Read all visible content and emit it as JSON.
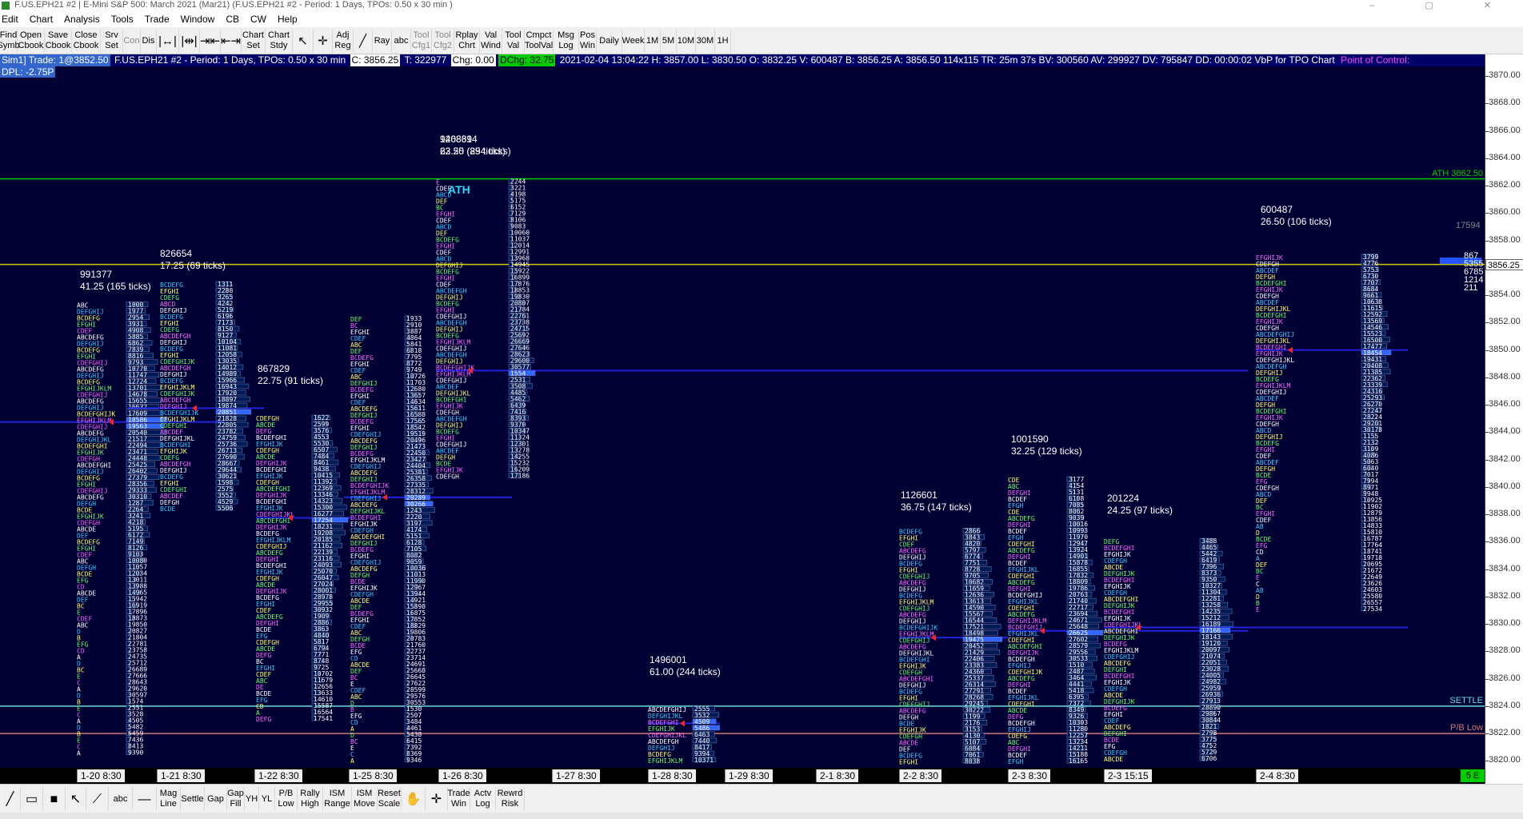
{
  "window": {
    "title": "F.US.EPH21  #2 | E-Mini S&P 500: March 2021 (Mar21) (F.US.EPH21  #2 - Period: 1 Days, TPOs: 0.50 x 30 min )"
  },
  "menu": [
    "Edit",
    "Chart",
    "Analysis",
    "Tools",
    "Trade",
    "Window",
    "CB",
    "CW",
    "Help"
  ],
  "toolbar": {
    "buttons": [
      {
        "label": "Find\nSymb",
        "icon": null,
        "enabled": true
      },
      {
        "label": "Open\nCbook",
        "icon": null,
        "enabled": true
      },
      {
        "label": "Save\nCbook",
        "icon": null,
        "enabled": true
      },
      {
        "label": "Close\nCbook",
        "icon": null,
        "enabled": true
      },
      {
        "label": "Srv\nSet",
        "icon": null,
        "enabled": true
      },
      {
        "label": "Con",
        "icon": null,
        "enabled": false
      },
      {
        "label": "Dis",
        "icon": null,
        "enabled": true
      },
      {
        "label": "",
        "icon": "zoom-out-bars-icon",
        "enabled": true
      },
      {
        "label": "",
        "icon": "zoom-in-bars-icon",
        "enabled": true
      },
      {
        "label": "",
        "icon": "compress-icon",
        "enabled": true
      },
      {
        "label": "",
        "icon": "expand-icon",
        "enabled": true
      },
      {
        "label": "Chart\nSet",
        "icon": null,
        "enabled": true
      },
      {
        "label": "Chart\nStdy",
        "icon": null,
        "enabled": true
      },
      {
        "label": "",
        "icon": "pointer-icon",
        "enabled": true
      },
      {
        "label": "",
        "icon": "crosshair-icon",
        "enabled": true
      },
      {
        "label": "Adj\nReg",
        "icon": null,
        "enabled": true
      },
      {
        "label": "",
        "icon": "line-draw-icon",
        "enabled": true
      },
      {
        "label": "Ray",
        "icon": null,
        "enabled": true
      },
      {
        "label": "abc",
        "icon": null,
        "enabled": true
      },
      {
        "label": "Tool\nCfg1",
        "icon": null,
        "enabled": false
      },
      {
        "label": "Tool\nCfg2",
        "icon": null,
        "enabled": false
      },
      {
        "label": "Rplay\nChrt",
        "icon": null,
        "enabled": true
      },
      {
        "label": "Val\nWind",
        "icon": null,
        "enabled": true
      },
      {
        "label": "Tool\nVal",
        "icon": null,
        "enabled": true
      },
      {
        "label": "Cmpct\nToolVal",
        "icon": null,
        "enabled": true
      },
      {
        "label": "Msg\nLog",
        "icon": null,
        "enabled": true
      },
      {
        "label": "Pos\nWin",
        "icon": null,
        "enabled": true
      },
      {
        "label": "Daily",
        "icon": null,
        "enabled": true
      },
      {
        "label": "Week",
        "icon": null,
        "enabled": true
      },
      {
        "label": "1M",
        "icon": null,
        "enabled": true
      },
      {
        "label": "5M",
        "icon": null,
        "enabled": true
      },
      {
        "label": "10M",
        "icon": null,
        "enabled": true
      },
      {
        "label": "30M",
        "icon": null,
        "enabled": true
      },
      {
        "label": "1H",
        "icon": null,
        "enabled": true
      }
    ]
  },
  "infobar": {
    "sim": "Sim1]  Trade: 1@3852.50",
    "symbol": "F.US.EPH21  #2 - Period: 1 Days, TPOs: 0.50 x 30 min",
    "c": "C: 3856.25",
    "t": "T: 322977",
    "chg": "Chg: 0.00",
    "dchg": "DChg: 32.75",
    "stats": "2021-02-04  13:04:22  H: 3857.00  L: 3830.50  O: 3832.25  V: 600487  B: 3856.25  A: 3856.50  114x115  TR: 25m 37s  BV: 300560  AV: 299927  DV: 795847  DD: 00:00:02  VbP for TPO Chart",
    "poc": "Point of Control:",
    "dpl": "DPL: -2.75P"
  },
  "dates": [
    "1-20  8:30",
    "1-21  8:30",
    "1-22  8:30",
    "1-25  8:30",
    "1-26  8:30",
    "1-27  8:30",
    "1-28  8:30",
    "1-29  8:30",
    "2-1  8:30",
    "2-2  8:30",
    "2-3  8:30",
    "2-3  15:15",
    "2-4  8:30"
  ],
  "date_corner": "5 E",
  "price_axis": {
    "labels": [
      "3870.00",
      "3868.00",
      "3866.00",
      "3864.00",
      "3862.00",
      "3860.00",
      "3858.00",
      "3856.00",
      "3854.00",
      "3852.00",
      "3850.00",
      "3848.00",
      "3846.00",
      "3844.00",
      "3842.00",
      "3840.00",
      "3838.00",
      "3836.00",
      "3834.00",
      "3832.00",
      "3830.00",
      "3828.00",
      "3826.00",
      "3824.00",
      "3822.00",
      "3820.00"
    ],
    "current": "3856.25"
  },
  "chart_data": {
    "type": "tpo-profile",
    "symbol": "F.US.EPH21",
    "y_range": [
      3819.5,
      3871
    ],
    "reference_lines": [
      {
        "name": "ATH",
        "label": "ATH  3862.50",
        "price": 3862.5,
        "color": "#00cc00"
      },
      {
        "name": "current",
        "price": 3856.25,
        "color": "#cccc00"
      },
      {
        "name": "SETTLE",
        "label": "SETTLE",
        "price": 3824.0,
        "color": "#66dddd"
      },
      {
        "name": "P/B Low",
        "label": "P/B Low",
        "price": 3822.0,
        "color": "#cc7777"
      }
    ],
    "right_vol": [
      {
        "label": "17594"
      },
      {
        "label": "867"
      },
      {
        "label": "5355"
      },
      {
        "label": "6785"
      },
      {
        "label": "1214"
      },
      {
        "label": "211"
      }
    ],
    "sessions": [
      {
        "date": "1-20",
        "volume": "991377",
        "range": "41.25 (165 ticks)",
        "high": 3853.5,
        "low": 3820.25,
        "poc": 3844.75
      },
      {
        "date": "1-21",
        "volume": "826654",
        "range": "17.25 (69 ticks)",
        "high": 3855.0,
        "low": 3837.75,
        "poc": 3845.75
      },
      {
        "date": "1-22",
        "volume": "867829",
        "range": "22.75 (91 ticks)",
        "high": 3845.25,
        "low": 3822.5,
        "poc": 3837.75
      },
      {
        "date": "1-25",
        "volume": "1468694",
        "range": "63.50 (254 ticks)",
        "high": 3852.5,
        "low": 3819.5,
        "poc": 3839.25
      },
      {
        "date": "1-26",
        "volume": "920831",
        "range": "22.25 (89 ticks)",
        "high": 3862.5,
        "low": 3840.25,
        "poc": 3848.5,
        "label": "ATH"
      },
      {
        "date": "1-27",
        "volume": "1496001",
        "range": "61.00 (244 ticks)",
        "high": 3824.0,
        "low": 3819.5,
        "poc": 3822.75
      },
      {
        "date": "2-2",
        "volume": "1126601",
        "range": "36.75 (147 ticks)",
        "high": 3837.0,
        "low": 3819.5,
        "poc": 3829.0
      },
      {
        "date": "2-3",
        "volume": "1001590",
        "range": "32.25 (129 ticks)",
        "high": 3840.75,
        "low": 3819.5,
        "poc": 3829.5
      },
      {
        "date": "2-3 15:15",
        "volume": "201224",
        "range": "24.25 (97 ticks)",
        "high": 3836.25,
        "low": 3819.5,
        "poc": 3829.75
      },
      {
        "date": "2-4",
        "volume": "600487",
        "range": "26.50 (106 ticks)",
        "high": 3857.0,
        "low": 3830.5,
        "poc": 3850.0
      }
    ]
  },
  "drawbar": {
    "buttons": [
      {
        "label": "",
        "icon": "line-tool-icon"
      },
      {
        "label": "",
        "icon": "rectangle-tool-icon"
      },
      {
        "label": "",
        "icon": "filled-rectangle-icon"
      },
      {
        "label": "",
        "icon": "arrow-pointer-icon"
      },
      {
        "label": "",
        "icon": "draw-line-icon"
      },
      {
        "label": "abc",
        "icon": null
      },
      {
        "label": "",
        "icon": "horizontal-line-icon"
      },
      {
        "label": "Mag\nLine",
        "icon": null
      },
      {
        "label": "Settle",
        "icon": null
      },
      {
        "label": "Gap",
        "icon": null
      },
      {
        "label": "Gap\nFill",
        "icon": null
      },
      {
        "label": "YH",
        "icon": null
      },
      {
        "label": "YL",
        "icon": null
      },
      {
        "label": "P/B\nLow",
        "icon": null
      },
      {
        "label": "Rally\nHigh",
        "icon": null
      },
      {
        "label": "ISM\nRange",
        "icon": null
      },
      {
        "label": "ISM\nMove",
        "icon": null
      },
      {
        "label": "Reset\nScale",
        "icon": null
      },
      {
        "label": "",
        "icon": "hand-pan-icon"
      },
      {
        "label": "",
        "icon": "crosshair-icon"
      },
      {
        "label": "Trade\nWin",
        "icon": null
      },
      {
        "label": "Actv\nLog",
        "icon": null
      },
      {
        "label": "Rewrd\nRisk",
        "icon": null
      }
    ]
  }
}
